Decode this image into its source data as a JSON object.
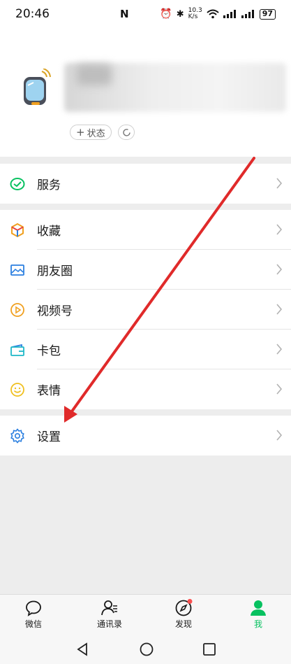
{
  "status_bar": {
    "time": "20:46",
    "net_speed_top": "10.3",
    "net_speed_bottom": "K/s",
    "battery": "97"
  },
  "profile": {
    "status_label": "状态",
    "status_plus": "+"
  },
  "menu": {
    "service": "服务",
    "favorites": "收藏",
    "moments": "朋友圈",
    "channels": "视频号",
    "cards": "卡包",
    "stickers": "表情",
    "settings": "设置"
  },
  "tabs": {
    "chats": "微信",
    "contacts": "通讯录",
    "discover": "发现",
    "me": "我"
  },
  "colors": {
    "accent_green": "#07c160",
    "arrow_red": "#e02a2a",
    "badge_red": "#fa5151"
  }
}
